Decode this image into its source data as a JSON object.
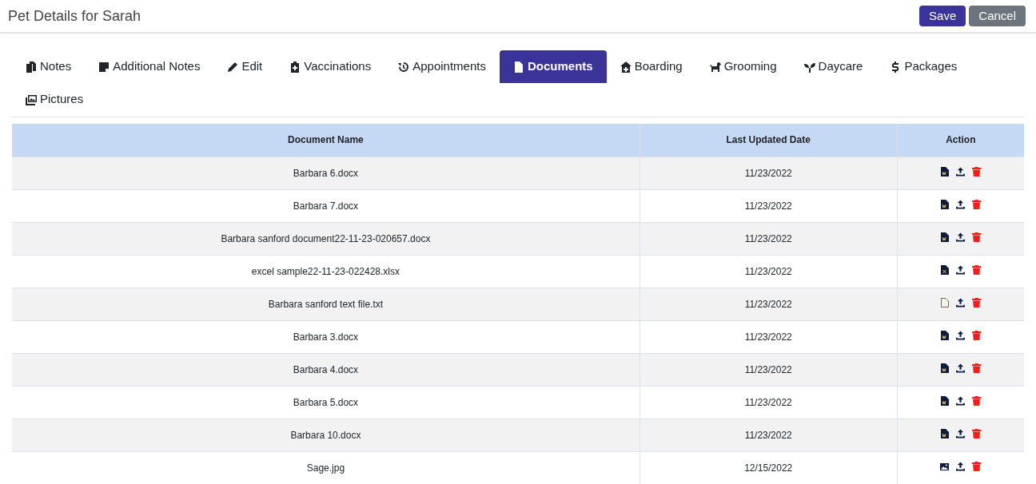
{
  "header": {
    "title": "Pet Details for Sarah",
    "buttons": [
      {
        "label": "Save",
        "kind": "primary"
      },
      {
        "label": "Cancel",
        "kind": "secondary"
      }
    ]
  },
  "tabs": [
    {
      "label": "Notes",
      "selected": false
    },
    {
      "label": "Additional Notes",
      "selected": false
    },
    {
      "label": "Edit",
      "selected": false
    },
    {
      "label": "Vaccinations",
      "selected": false
    },
    {
      "label": "Appointments",
      "selected": false
    },
    {
      "label": "Documents",
      "selected": true
    },
    {
      "label": "Boarding",
      "selected": false
    },
    {
      "label": "Grooming",
      "selected": false
    },
    {
      "label": "Daycare",
      "selected": false
    },
    {
      "label": "Packages",
      "selected": false
    },
    {
      "label": "Pictures",
      "selected": false
    }
  ],
  "table": {
    "columns": [
      "Document Name",
      "Last Updated Date",
      "Action"
    ],
    "rows": [
      {
        "name": "Barbara 6.docx",
        "date": "11/23/2022",
        "kind": "word"
      },
      {
        "name": "Barbara 7.docx",
        "date": "11/23/2022",
        "kind": "word"
      },
      {
        "name": "Barbara sanford document22-11-23-020657.docx",
        "date": "11/23/2022",
        "kind": "word"
      },
      {
        "name": "excel sample22-11-23-022428.xlsx",
        "date": "11/23/2022",
        "kind": "excel"
      },
      {
        "name": "Barbara sanford text file.txt",
        "date": "11/23/2022",
        "kind": "text"
      },
      {
        "name": "Barbara 3.docx",
        "date": "11/23/2022",
        "kind": "word"
      },
      {
        "name": "Barbara 4.docx",
        "date": "11/23/2022",
        "kind": "word"
      },
      {
        "name": "Barbara 5.docx",
        "date": "11/23/2022",
        "kind": "word"
      },
      {
        "name": "Barbara 10.docx",
        "date": "11/23/2022",
        "kind": "word"
      },
      {
        "name": "Sage.jpg",
        "date": "12/15/2022",
        "kind": "image"
      }
    ]
  }
}
